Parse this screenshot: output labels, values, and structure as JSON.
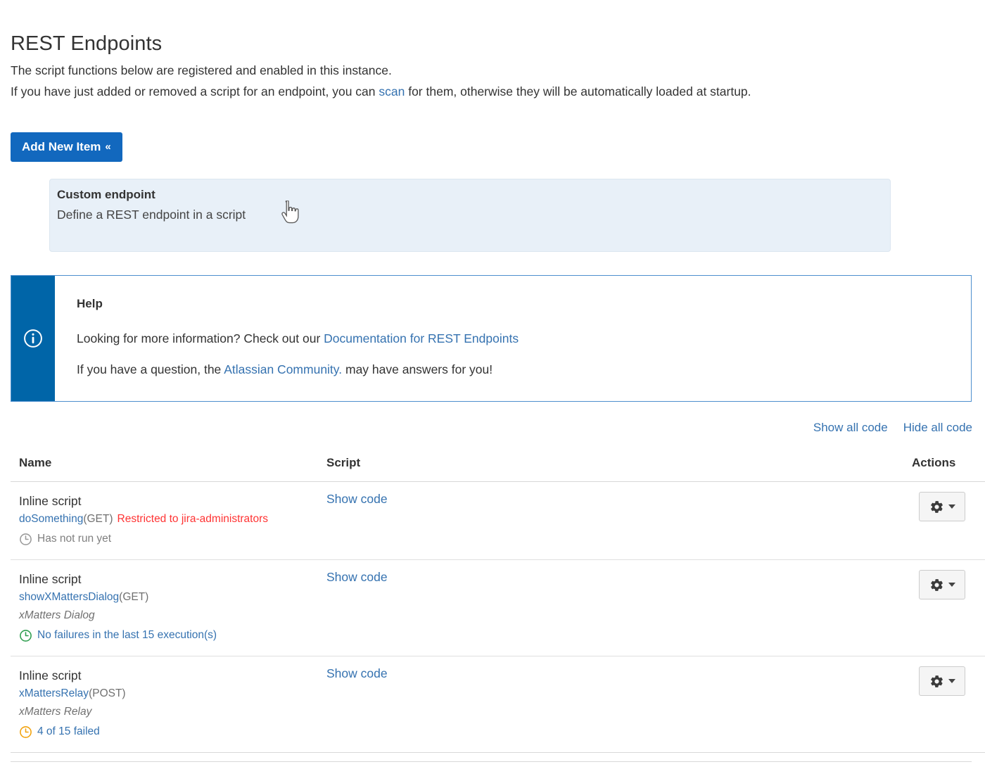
{
  "page": {
    "title": "REST Endpoints",
    "intro_line1": "The script functions below are registered and enabled in this instance.",
    "intro_line2_before": "If you have just added or removed a script for an endpoint, you can ",
    "intro_scan_link": "scan",
    "intro_line2_after": " for them, otherwise they will be automatically loaded at startup."
  },
  "toolbar": {
    "add_new_item_label": "Add New Item",
    "add_new_item_caret": "«"
  },
  "add_panel": {
    "option_title": "Custom endpoint",
    "option_description": "Define a REST endpoint in a script"
  },
  "help": {
    "icon": "info-icon",
    "heading": "Help",
    "line1_before": "Looking for more information? Check out our ",
    "line1_link": "Documentation for REST Endpoints",
    "line2_before": "If you have a question, the ",
    "line2_link": "Atlassian Community.",
    "line2_after": " may have answers for you!"
  },
  "code_toggles": {
    "show_all": "Show all code",
    "hide_all": "Hide all code"
  },
  "table": {
    "headers": {
      "name": "Name",
      "script": "Script",
      "actions": "Actions"
    },
    "rows": [
      {
        "type": "Inline script",
        "fn_name": "doSomething",
        "fn_method": "(GET)",
        "restricted": "Restricted to jira-administrators",
        "note": "",
        "status_icon": "clock-icon-grey",
        "status_color": "#9a9a9a",
        "status_text": "Has not run yet",
        "status_style": "grey",
        "script_link": "Show code"
      },
      {
        "type": "Inline script",
        "fn_name": "showXMattersDialog",
        "fn_method": "(GET)",
        "restricted": "",
        "note": "xMatters Dialog",
        "status_icon": "clock-icon-green",
        "status_color": "#2e9e4f",
        "status_text": "No failures in the last 15 execution(s)",
        "status_style": "link",
        "script_link": "Show code"
      },
      {
        "type": "Inline script",
        "fn_name": "xMattersRelay",
        "fn_method": "(POST)",
        "restricted": "",
        "note": "xMatters Relay",
        "status_icon": "clock-icon-orange",
        "status_color": "#f2a20c",
        "status_text": "4 of 15 failed",
        "status_style": "link",
        "script_link": "Show code"
      }
    ],
    "actions_button": {
      "icon": "gear-icon",
      "caret": "chevron-down-icon"
    }
  },
  "colors": {
    "primary_blue": "#1268be",
    "link_blue": "#3572b0",
    "help_bar_blue": "#0065a8",
    "panel_bg": "#e8f0f8",
    "restricted_red": "#ff3333",
    "status_green": "#2e9e4f",
    "status_orange": "#f2a20c",
    "status_grey": "#9a9a9a"
  }
}
